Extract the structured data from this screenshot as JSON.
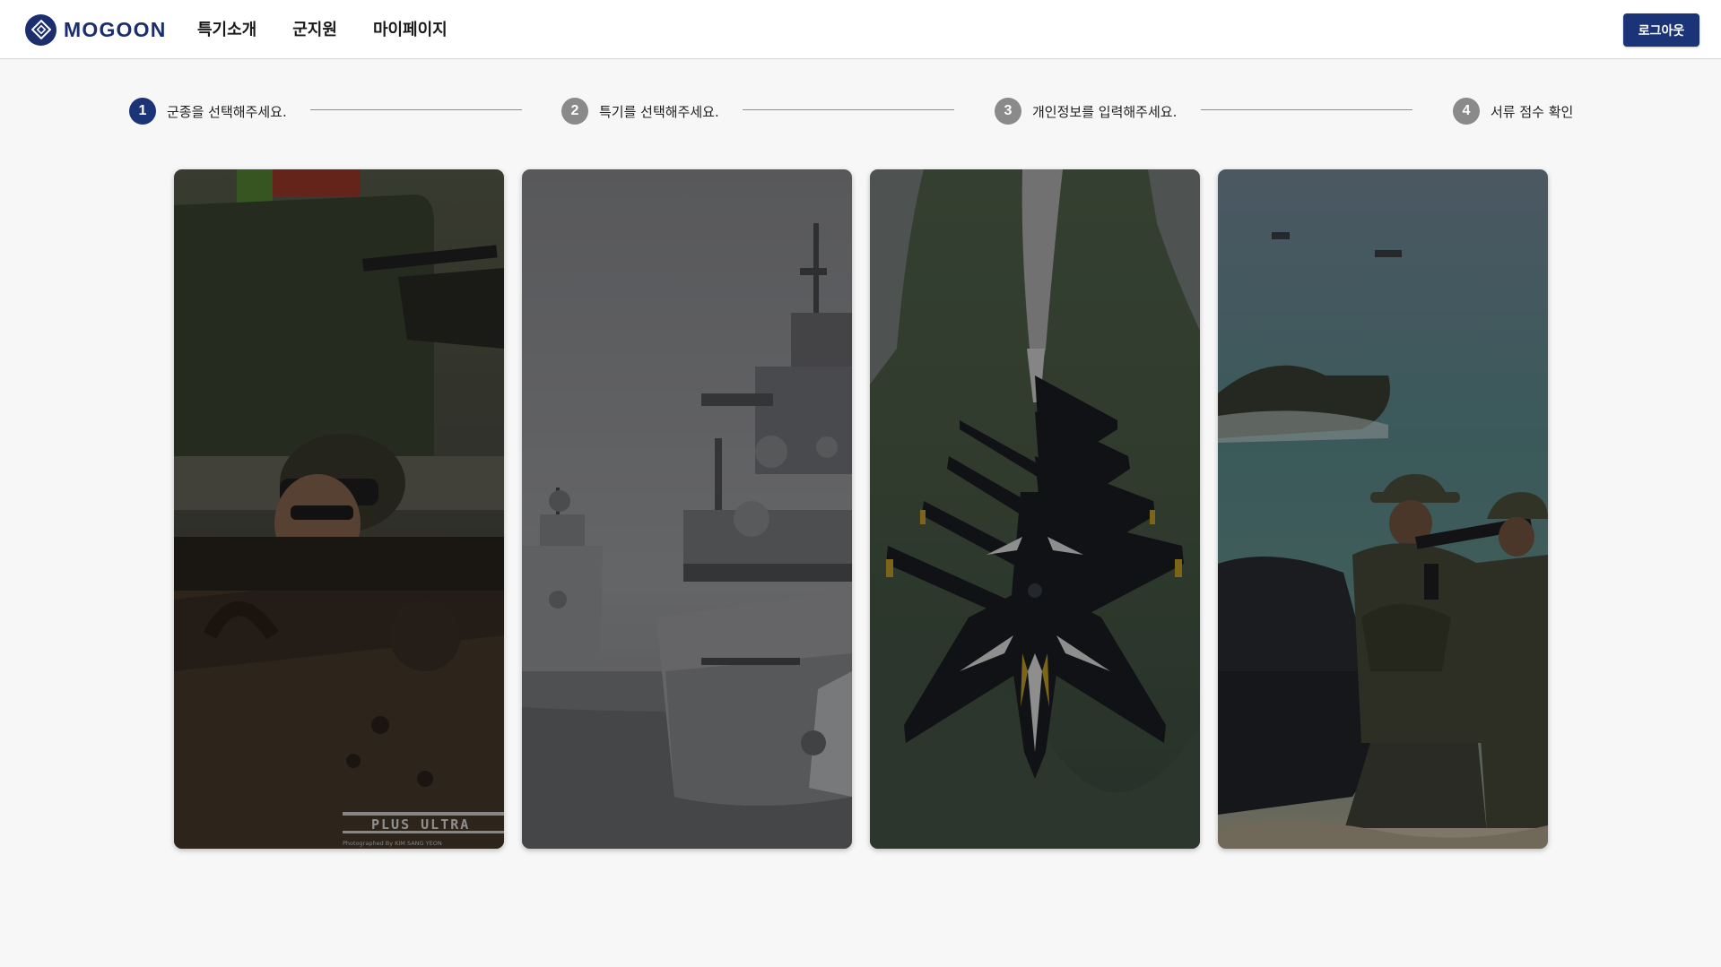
{
  "header": {
    "logo_text": "MOGOON",
    "logo_icon": "diamond-logo-icon",
    "nav": [
      "특기소개",
      "군지원",
      "마이페이지"
    ],
    "logout_label": "로그아웃",
    "brand_color": "#1b3478"
  },
  "stepper": {
    "active_step": 1,
    "steps": [
      {
        "num": "1",
        "label": "군종을 선택해주세요."
      },
      {
        "num": "2",
        "label": "특기를 선택해주세요."
      },
      {
        "num": "3",
        "label": "개인정보를 입력해주세요."
      },
      {
        "num": "4",
        "label": "서류 점수 확인"
      }
    ]
  },
  "cards": [
    {
      "name": "army",
      "image": "soldier-in-armored-vehicle-photo",
      "watermark": "PLUS ULTRA",
      "credit": "Photographed   By   KIM SANG YEON"
    },
    {
      "name": "navy",
      "image": "warships-at-sea-photo"
    },
    {
      "name": "air-force",
      "image": "jet-formation-flight-photo"
    },
    {
      "name": "marines",
      "image": "marines-beach-landing-photo"
    }
  ]
}
